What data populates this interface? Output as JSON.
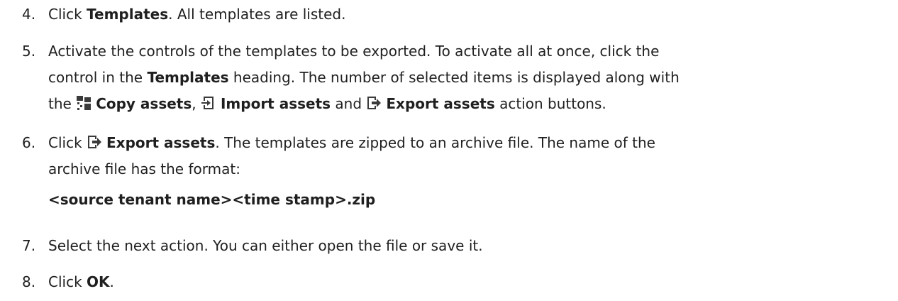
{
  "steps": [
    {
      "num": "4.",
      "parts": {
        "a": "Click ",
        "b": "Templates",
        "c": ". All templates are listed."
      }
    },
    {
      "num": "5.",
      "line1": "Activate the controls of the templates to be exported. To activate all at once, click the",
      "line2_a": "control in the ",
      "line2_b": "Templates",
      "line2_c": " heading. The number of selected items is displayed along with",
      "line3_a": "the ",
      "copy_label": "Copy assets",
      "sep1": ", ",
      "import_label": "Import assets",
      "and": " and ",
      "export_label": "Export assets",
      "line3_end": " action buttons."
    },
    {
      "num": "6.",
      "line1_a": "Click ",
      "export_label": "Export assets",
      "line1_b": ". The templates are zipped to an archive file. The name of the",
      "line2": "archive file has the format:",
      "format": "<source tenant name><time stamp>.zip"
    },
    {
      "num": "7.",
      "text": "Select the next action. You can either open the file or save it."
    },
    {
      "num": "8.",
      "a": "Click ",
      "b": "OK",
      "c": "."
    }
  ],
  "icons": {
    "copy": "copy-assets-icon",
    "import": "import-assets-icon",
    "export": "export-assets-icon"
  },
  "colors": {
    "text": "#1f1f1f",
    "icon": "#3a3a3a"
  }
}
